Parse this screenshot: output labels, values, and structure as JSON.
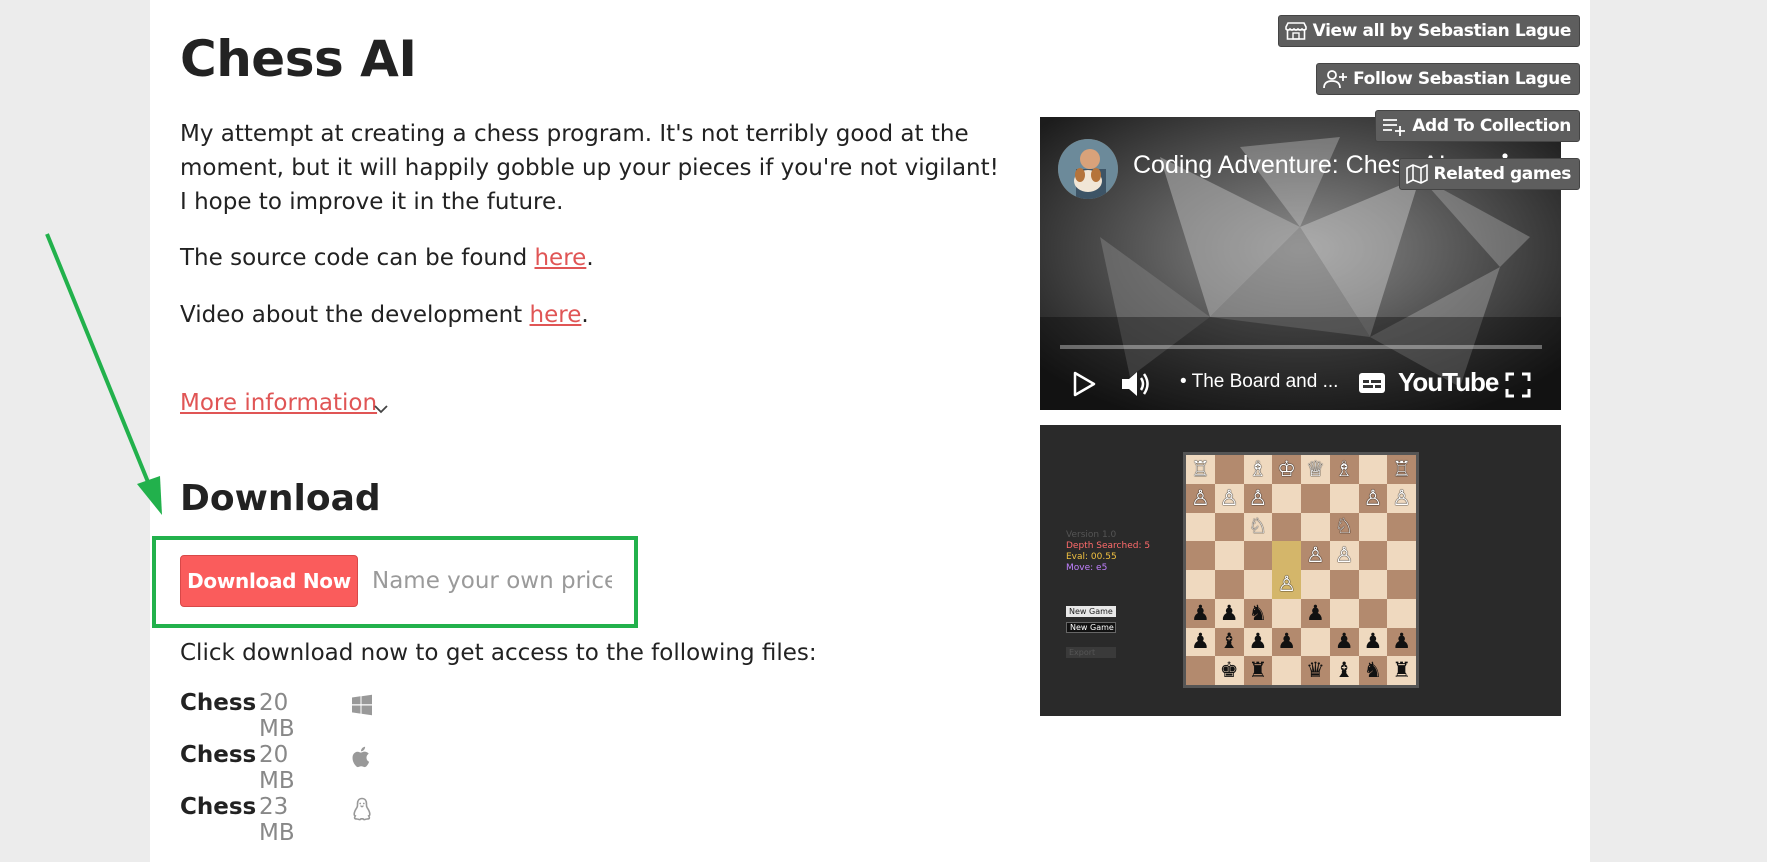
{
  "title": "Chess AI",
  "description": "My attempt at creating a chess program. It's not terribly good at the moment, but it will happily gobble up your pieces if you're not vigilant! I hope to improve it in the future.",
  "source_line": {
    "prefix": "The source code can be found ",
    "link": "here",
    "suffix": "."
  },
  "video_line": {
    "prefix": "Video about the development ",
    "link": "here",
    "suffix": "."
  },
  "more_info": "More information",
  "download": {
    "heading": "Download",
    "button_label": "Download Now",
    "price_placeholder": "Name your own price",
    "files_intro": "Click download now to get access to the following files:",
    "files": [
      {
        "name": "Chess",
        "size": "20 MB",
        "platform_icon": "windows-icon"
      },
      {
        "name": "Chess",
        "size": "20 MB",
        "platform_icon": "apple-icon"
      },
      {
        "name": "Chess",
        "size": "23 MB",
        "platform_icon": "linux-icon"
      }
    ]
  },
  "video": {
    "title": "Coding Adventure: Chess AI",
    "chapter": "• The Board and ...",
    "brand": "YouTube"
  },
  "screenshot": {
    "version": "Version 1.0",
    "depth": "Depth Searched: 5",
    "eval": "Eval: 00.55",
    "move": "Move: e5",
    "new_game_1": "New Game",
    "new_game_2": "New Game",
    "export": "Export",
    "board": [
      [
        "♖",
        "",
        "♗",
        "♔",
        "♕",
        "♗",
        "",
        "♖"
      ],
      [
        "♙",
        "♙",
        "♙",
        "",
        "",
        "",
        "♙",
        "♙"
      ],
      [
        "",
        "",
        "♘",
        "",
        "",
        "♘",
        "",
        ""
      ],
      [
        "",
        "",
        "",
        "",
        "♙",
        "♙",
        "",
        ""
      ],
      [
        "",
        "",
        "",
        "♙",
        "",
        "",
        "",
        ""
      ],
      [
        "♟",
        "♟",
        "♞",
        "",
        "♟",
        "",
        "",
        ""
      ],
      [
        "♟",
        "♝",
        "♟",
        "♟",
        "",
        "♟",
        "♟",
        "♟"
      ],
      [
        "",
        "♚",
        "♜",
        "",
        "♛",
        "♝",
        "♞",
        "♜"
      ]
    ],
    "highlight_squares": [
      [
        3,
        3
      ],
      [
        4,
        3
      ]
    ]
  },
  "sidebar_buttons": {
    "view_all": "View all by Sebastian Lague",
    "follow": "Follow Sebastian Lague",
    "add_collection": "Add To Collection",
    "related": "Related games"
  },
  "colors": {
    "accent": "#fa5c5c",
    "annotation": "#22b14c",
    "side_button": "#5e5e5e"
  }
}
